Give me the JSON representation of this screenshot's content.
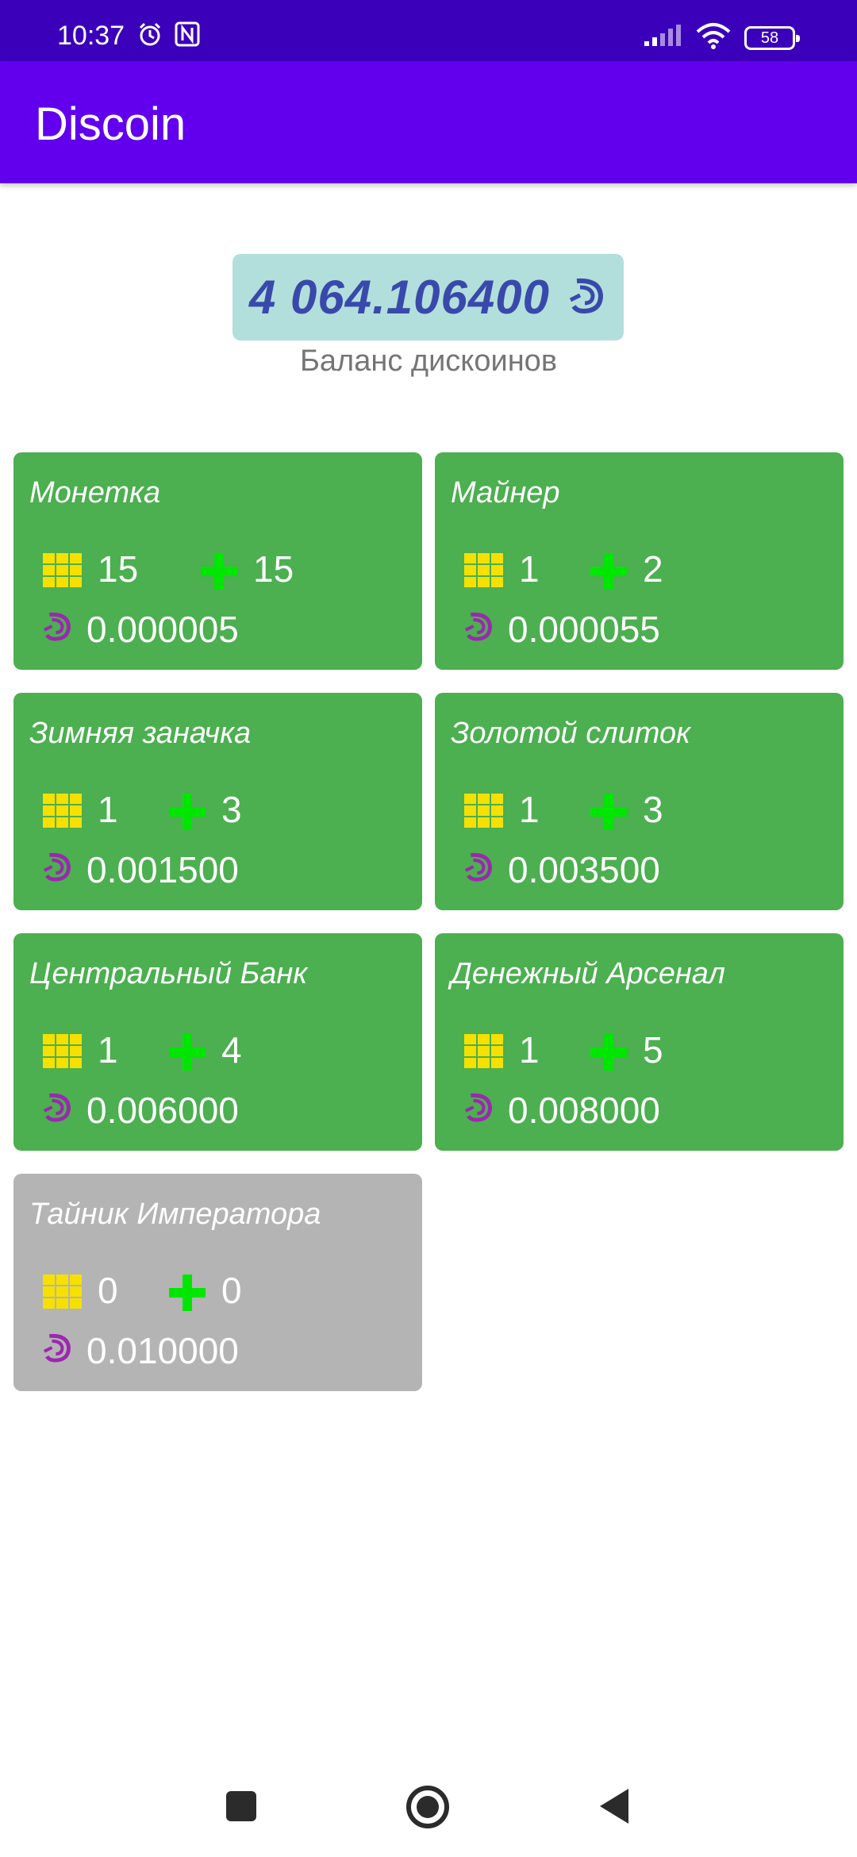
{
  "status_bar": {
    "time": "10:37",
    "battery": "58",
    "icons": [
      "alarm-icon",
      "nfc-icon",
      "signal-icon",
      "wifi-icon",
      "battery-icon"
    ]
  },
  "app_bar": {
    "title": "Discoin"
  },
  "balance": {
    "value": "4 064.106400",
    "label": "Баланс дискоинов",
    "box_color": "#b2dfdb",
    "text_color": "#3949ab"
  },
  "colors": {
    "active_card": "#4caf50",
    "inactive_card": "#b4b4b4",
    "grid_icon": "#f6e000",
    "plus_icon": "#00e600",
    "coin_icon": "#9c27b0"
  },
  "cards": [
    {
      "title": "Монетка",
      "count": "15",
      "plus": "15",
      "income": "0.000005",
      "active": true
    },
    {
      "title": "Майнер",
      "count": "1",
      "plus": "2",
      "income": "0.000055",
      "active": true
    },
    {
      "title": "Зимняя заначка",
      "count": "1",
      "plus": "3",
      "income": "0.001500",
      "active": true
    },
    {
      "title": "Золотой слиток",
      "count": "1",
      "plus": "3",
      "income": "0.003500",
      "active": true
    },
    {
      "title": "Центральный Банк",
      "count": "1",
      "plus": "4",
      "income": "0.006000",
      "active": true
    },
    {
      "title": "Денежный Арсенал",
      "count": "1",
      "plus": "5",
      "income": "0.008000",
      "active": true
    },
    {
      "title": "Тайник Императора",
      "count": "0",
      "plus": "0",
      "income": "0.010000",
      "active": false
    }
  ],
  "nav_bar": {
    "buttons": [
      "recents-button",
      "home-button",
      "back-button"
    ]
  }
}
